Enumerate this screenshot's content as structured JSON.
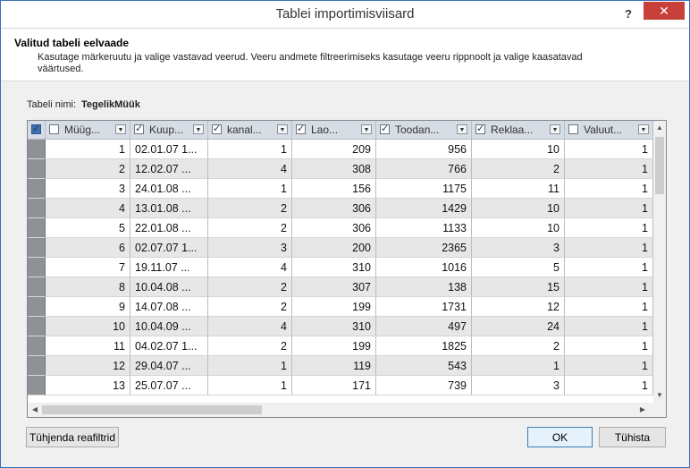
{
  "window": {
    "title": "Tablei importimisviisard",
    "help_label": "?",
    "close_label": "✕"
  },
  "header": {
    "title": "Valitud tabeli eelvaade",
    "description": "Kasutage märkeruutu ja valige vastavad veerud. Veeru andmete filtreerimiseks kasutage veeru rippnoolt ja valige kaasatavad väärtused."
  },
  "table_name": {
    "label": "Tabeli nimi:",
    "value": "TegelikMüük"
  },
  "columns": [
    {
      "label": "Müüg...",
      "checked": false
    },
    {
      "label": "Kuup...",
      "checked": true
    },
    {
      "label": "kanal...",
      "checked": true
    },
    {
      "label": "Lao...",
      "checked": true
    },
    {
      "label": "Toodan...",
      "checked": true
    },
    {
      "label": "Reklaa...",
      "checked": true
    },
    {
      "label": "Valuut...",
      "checked": false
    }
  ],
  "rows": [
    [
      "1",
      "02.01.07 1...",
      "1",
      "209",
      "956",
      "10",
      "1"
    ],
    [
      "2",
      "12.02.07 ...",
      "4",
      "308",
      "766",
      "2",
      "1"
    ],
    [
      "3",
      "24.01.08 ...",
      "1",
      "156",
      "1175",
      "11",
      "1"
    ],
    [
      "4",
      "13.01.08 ...",
      "2",
      "306",
      "1429",
      "10",
      "1"
    ],
    [
      "5",
      "22.01.08 ...",
      "2",
      "306",
      "1133",
      "10",
      "1"
    ],
    [
      "6",
      "02.07.07 1...",
      "3",
      "200",
      "2365",
      "3",
      "1"
    ],
    [
      "7",
      "19.11.07 ...",
      "4",
      "310",
      "1016",
      "5",
      "1"
    ],
    [
      "8",
      "10.04.08 ...",
      "2",
      "307",
      "138",
      "15",
      "1"
    ],
    [
      "9",
      "14.07.08 ...",
      "2",
      "199",
      "1731",
      "12",
      "1"
    ],
    [
      "10",
      "10.04.09 ...",
      "4",
      "310",
      "497",
      "24",
      "1"
    ],
    [
      "11",
      "04.02.07 1...",
      "2",
      "199",
      "1825",
      "2",
      "1"
    ],
    [
      "12",
      "29.04.07 ...",
      "1",
      "119",
      "543",
      "1",
      "1"
    ],
    [
      "13",
      "25.07.07 ...",
      "1",
      "171",
      "739",
      "3",
      "1"
    ]
  ],
  "buttons": {
    "clear_filters": "Tühjenda reafiltrid",
    "ok": "OK",
    "cancel": "Tühista"
  }
}
